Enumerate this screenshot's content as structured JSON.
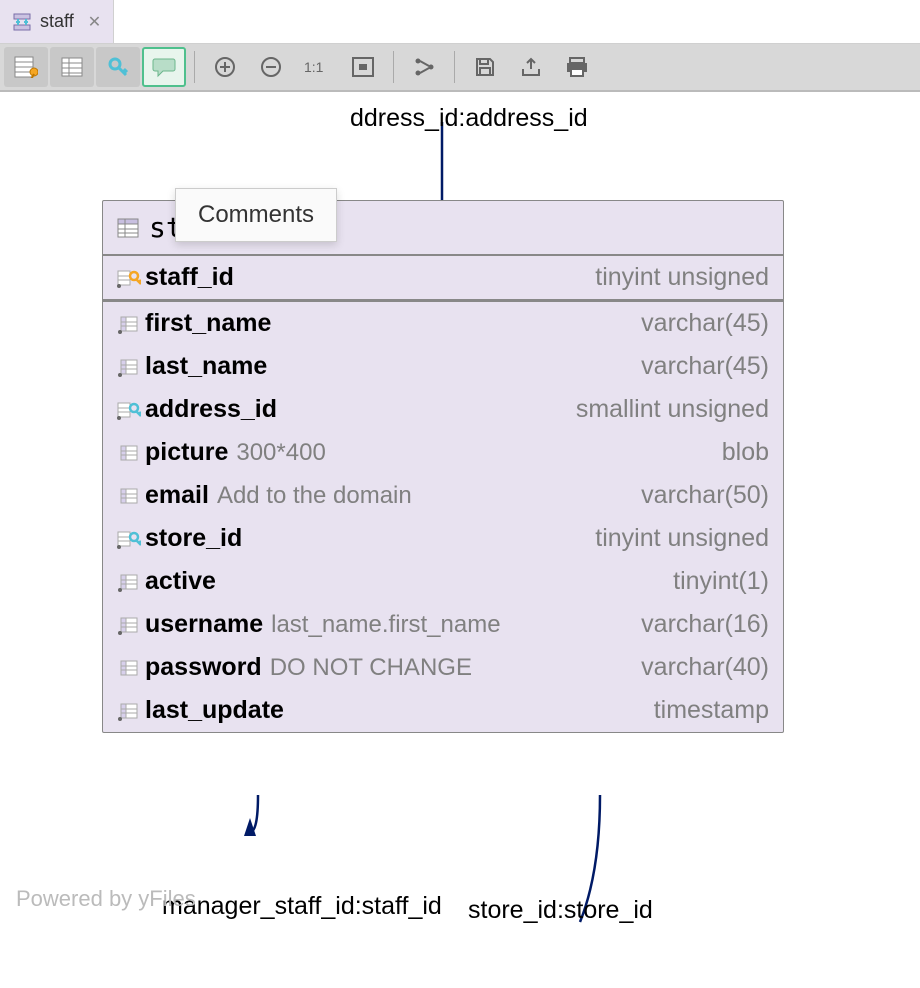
{
  "tab": {
    "label": "staff"
  },
  "tooltip": "Comments",
  "relations": {
    "top": "ddress_id:address_id",
    "bottom_left": "manager_staff_id:staff_id",
    "bottom_right": "store_id:store_id"
  },
  "watermark": "Powered by yFiles",
  "table": {
    "name": "staff",
    "primary_key": {
      "name": "staff_id",
      "type": "tinyint unsigned",
      "icon": "pk"
    },
    "columns": [
      {
        "name": "first_name",
        "type": "varchar(45)",
        "comment": "",
        "icon": "col"
      },
      {
        "name": "last_name",
        "type": "varchar(45)",
        "comment": "",
        "icon": "col"
      },
      {
        "name": "address_id",
        "type": "smallint unsigned",
        "comment": "",
        "icon": "fk"
      },
      {
        "name": "picture",
        "type": "blob",
        "comment": "300*400",
        "icon": "col-nn"
      },
      {
        "name": "email",
        "type": "varchar(50)",
        "comment": "Add to the domain",
        "icon": "col-nn"
      },
      {
        "name": "store_id",
        "type": "tinyint unsigned",
        "comment": "",
        "icon": "fk"
      },
      {
        "name": "active",
        "type": "tinyint(1)",
        "comment": "",
        "icon": "col"
      },
      {
        "name": "username",
        "type": "varchar(16)",
        "comment": "last_name.first_name",
        "icon": "col"
      },
      {
        "name": "password",
        "type": "varchar(40)",
        "comment": "DO NOT CHANGE",
        "icon": "col-nn"
      },
      {
        "name": "last_update",
        "type": "timestamp",
        "comment": "",
        "icon": "col"
      }
    ]
  }
}
